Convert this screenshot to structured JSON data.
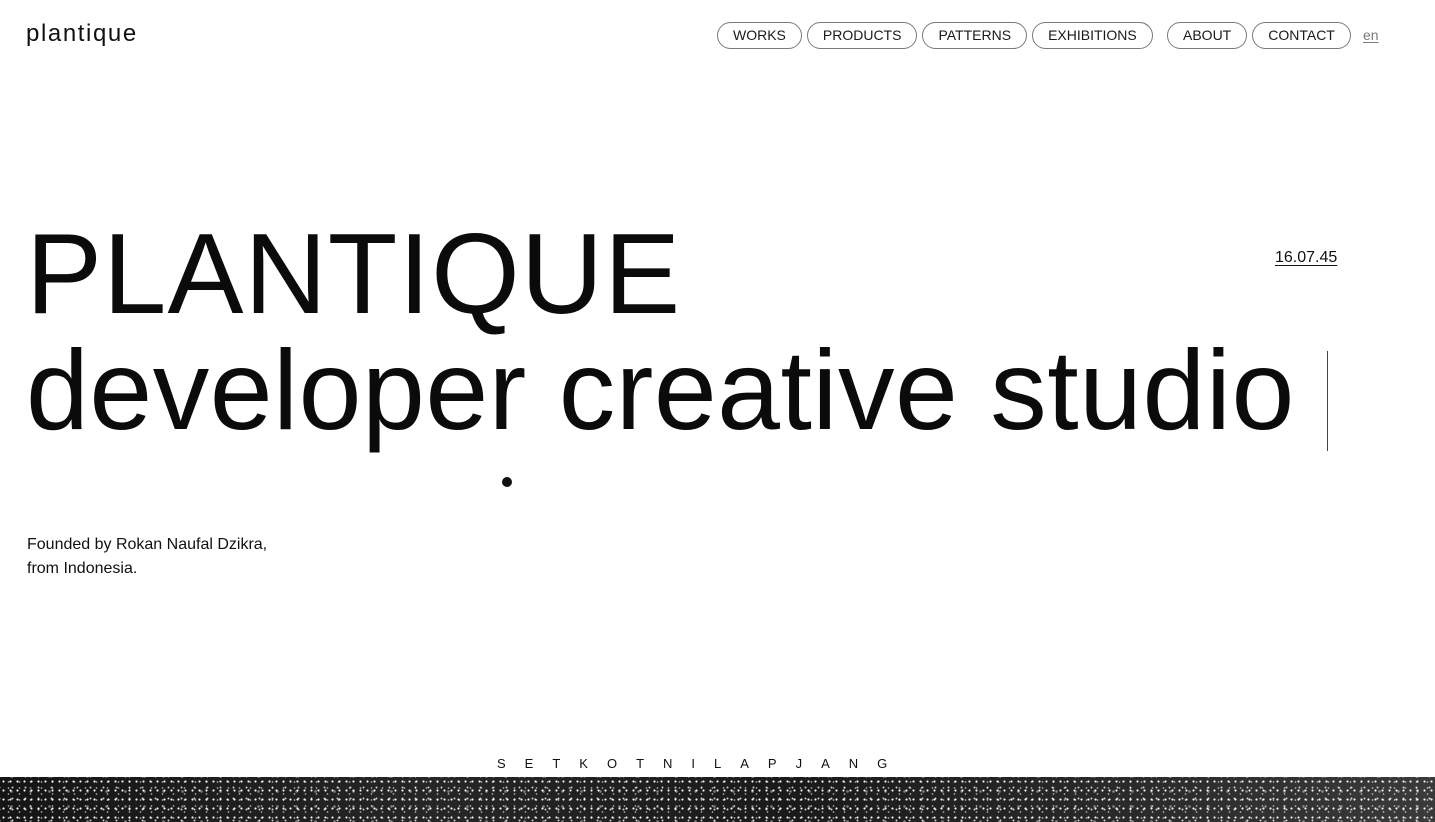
{
  "header": {
    "logo": "plantique",
    "nav_primary": [
      "WORKS",
      "PRODUCTS",
      "PATTERNS",
      "EXHIBITIONS"
    ],
    "nav_secondary": [
      "ABOUT",
      "CONTACT"
    ],
    "language": "en"
  },
  "hero": {
    "title": "PLANTIQUE",
    "subtitle": "developer creative studio",
    "clock": "16.07.45"
  },
  "about": {
    "line1": "Founded by Rokan Naufal Dzikra,",
    "line2": "from Indonesia."
  },
  "ticker": {
    "text": "SETKOTNILAPJANG"
  }
}
